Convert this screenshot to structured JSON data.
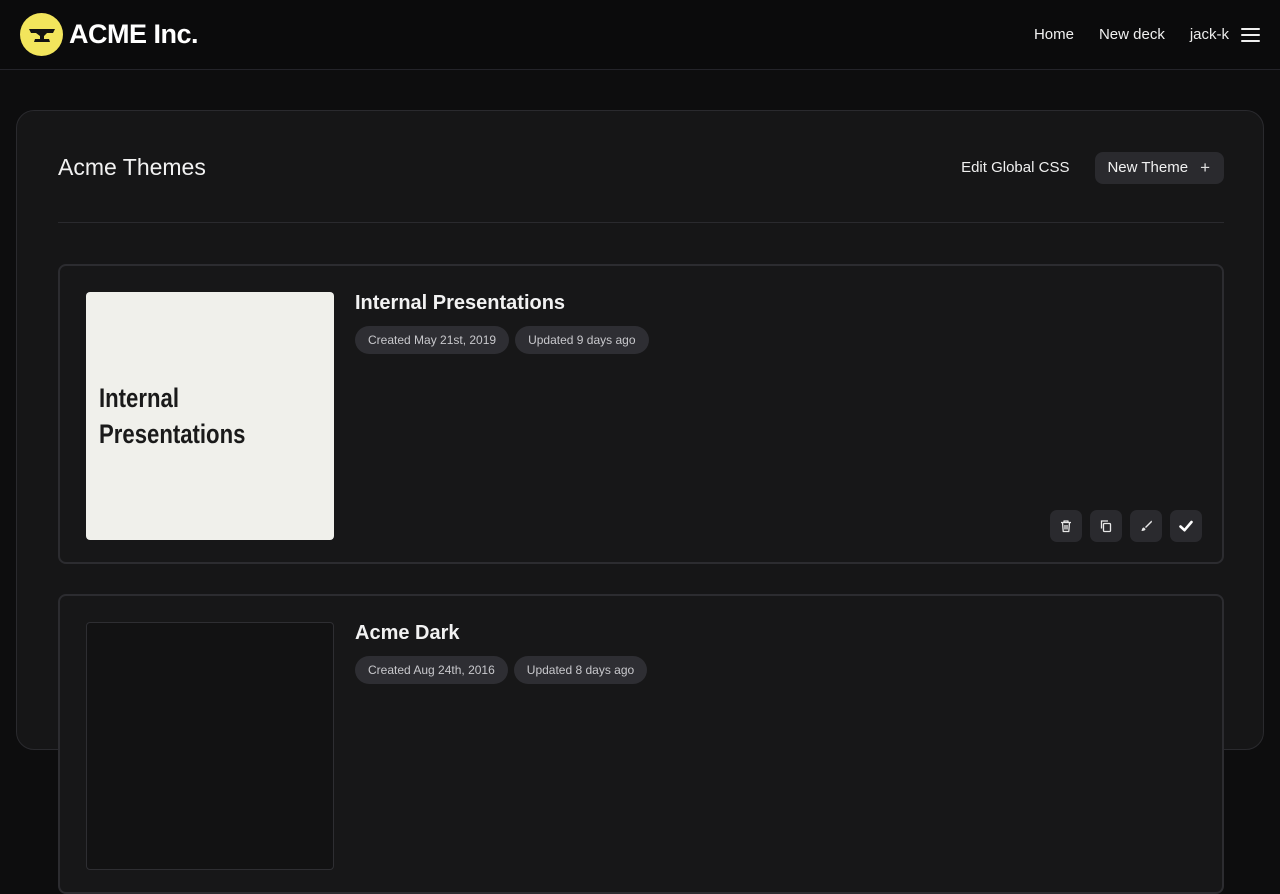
{
  "brand": {
    "name": "ACME Inc.",
    "logo_color": "#f2e55c",
    "logo_icon": "anvil-icon"
  },
  "nav": {
    "home": "Home",
    "new_deck": "New deck",
    "user": "jack-k",
    "menu_icon": "hamburger-menu-icon"
  },
  "page": {
    "title": "Acme Themes",
    "edit_global_css": "Edit Global CSS",
    "new_theme": "New Theme",
    "new_theme_icon": "+"
  },
  "themes": [
    {
      "name": "Internal Presentations",
      "thumbnail_text": "Internal Presentations",
      "thumbnail_bg": "#f0f0eb",
      "created": "Created May 21st, 2019",
      "updated": "Updated 9 days ago",
      "actions": [
        "trash-icon",
        "copy-icon",
        "brush-icon",
        "check-icon"
      ]
    },
    {
      "name": "Acme Dark",
      "thumbnail_bg": "#121213",
      "created": "Created Aug 24th, 2016",
      "updated": "Updated 8 days ago"
    }
  ]
}
